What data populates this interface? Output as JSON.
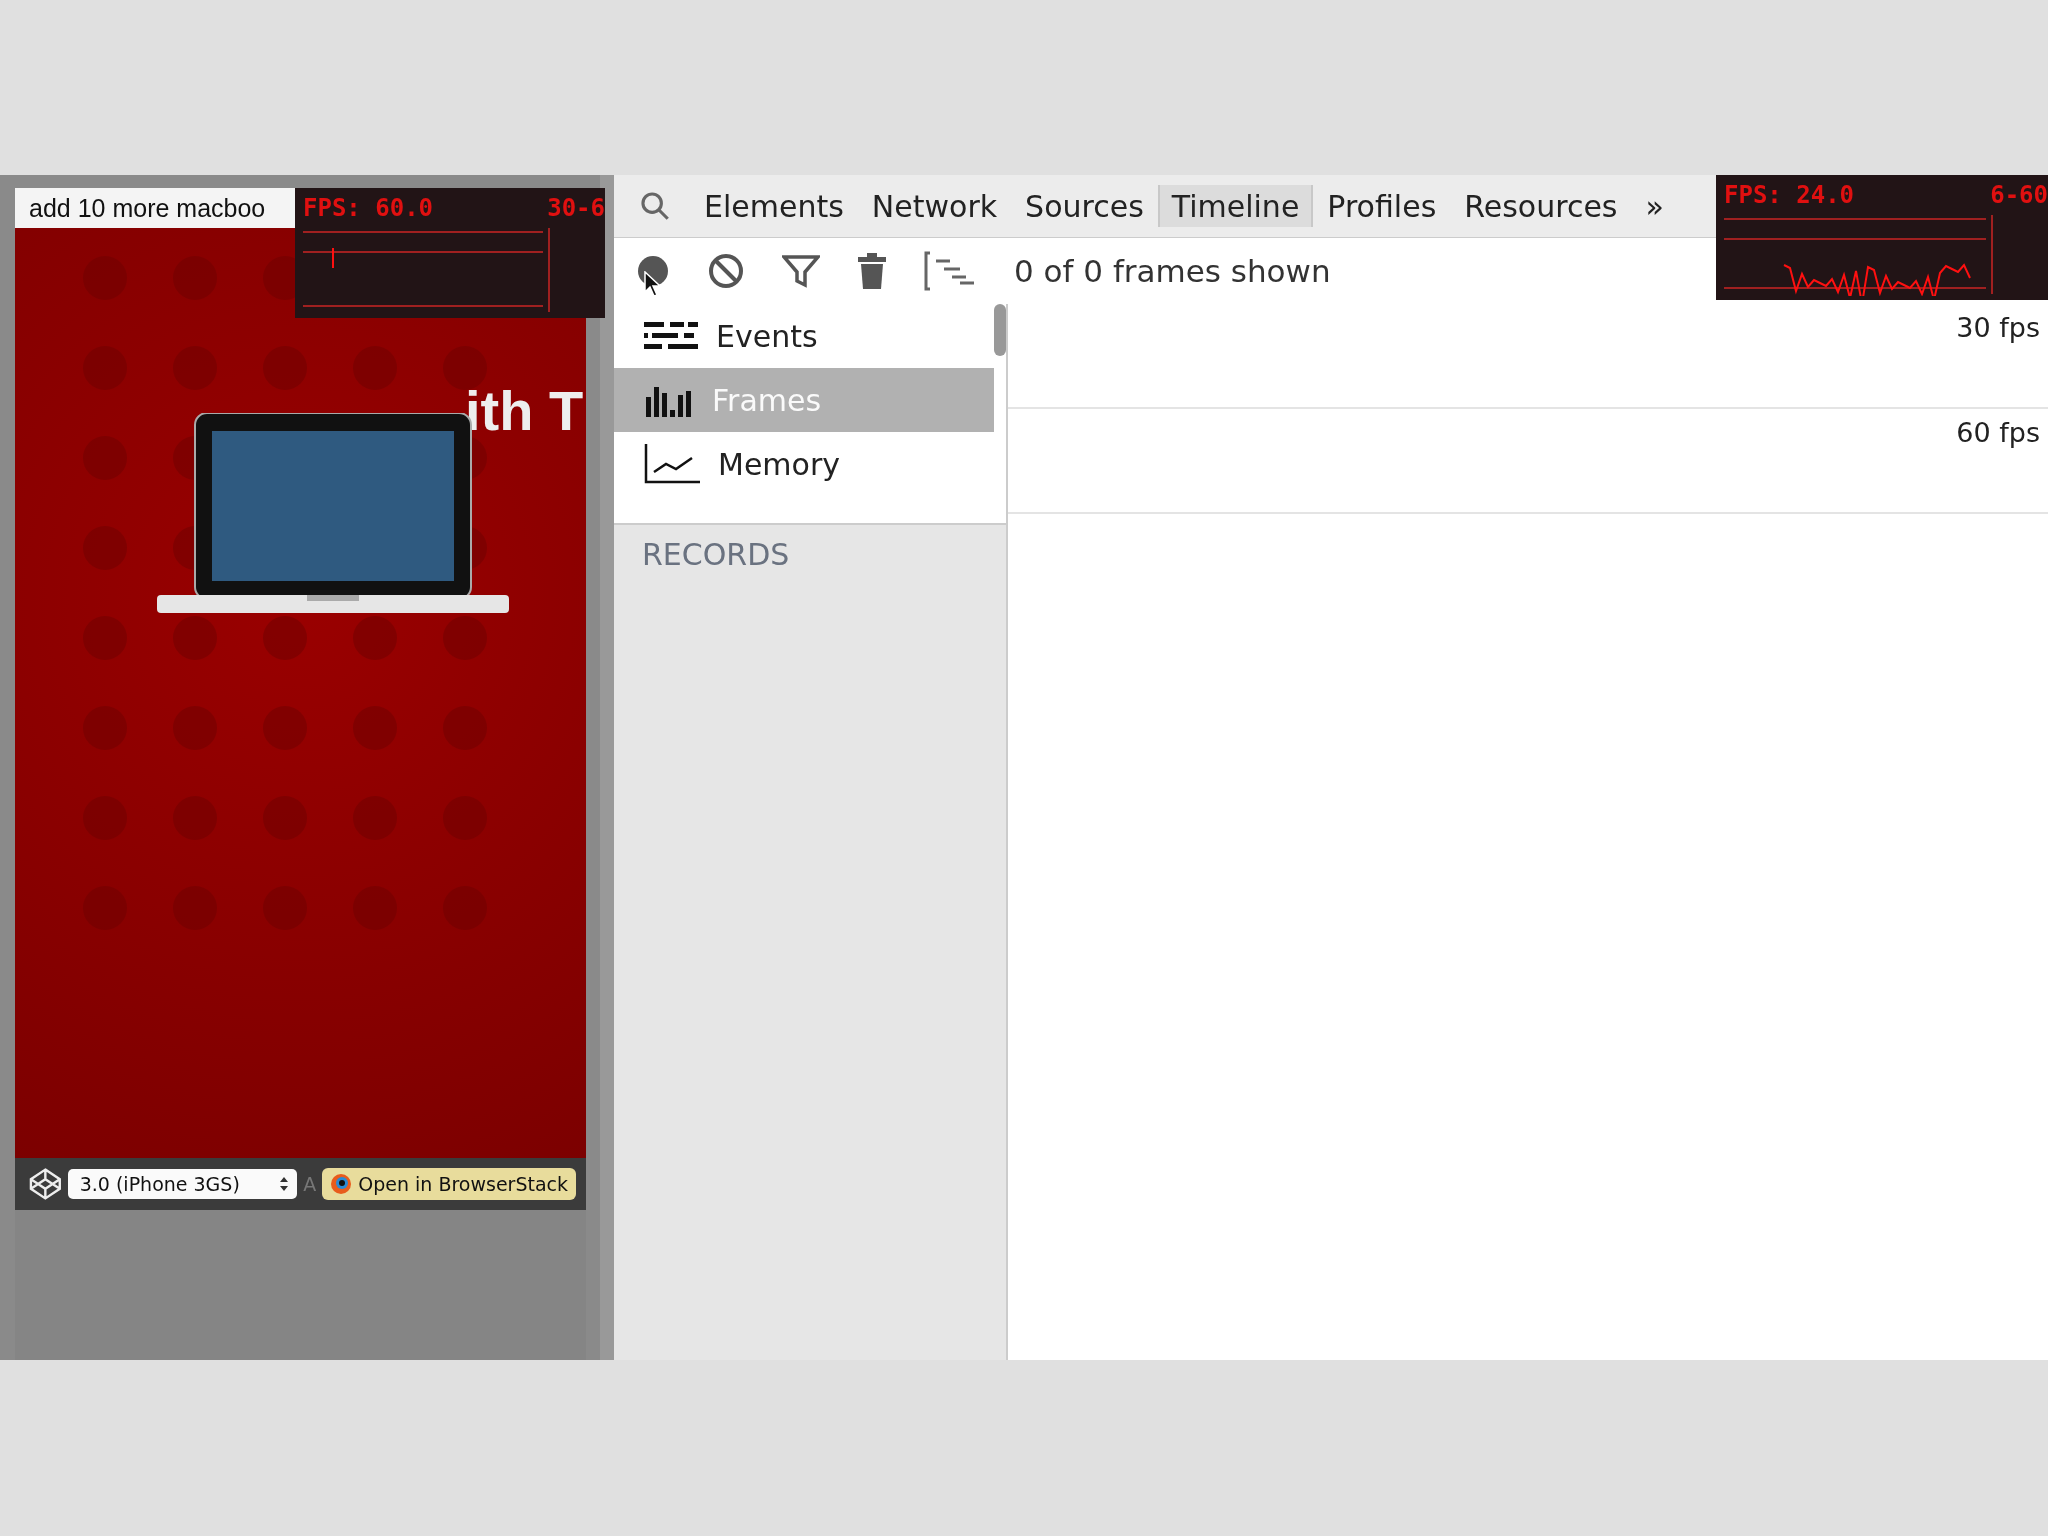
{
  "preview": {
    "top_button": "add 10 more macboo",
    "fps_meter": {
      "reading": "FPS: 60.0",
      "range": "30-6"
    },
    "heading_right": "ith T",
    "device_select": {
      "value": "3.0 (iPhone 3GS)"
    },
    "stray_letter": "A",
    "browserstack_button": "Open in BrowserStack"
  },
  "devtools": {
    "tabs": [
      {
        "label": "Elements",
        "selected": false
      },
      {
        "label": "Network",
        "selected": false
      },
      {
        "label": "Sources",
        "selected": false
      },
      {
        "label": "Timeline",
        "selected": true
      },
      {
        "label": "Profiles",
        "selected": false
      },
      {
        "label": "Resources",
        "selected": false
      }
    ],
    "more": "»",
    "fps_meter": {
      "reading": "FPS: 24.0",
      "range": "6-60"
    },
    "toolbar": {
      "recording": false,
      "status": "0 of 0 frames shown"
    },
    "sidebar": {
      "items": [
        {
          "label": "Events",
          "kind": "events",
          "selected": false
        },
        {
          "label": "Frames",
          "kind": "frames",
          "selected": true
        },
        {
          "label": "Memory",
          "kind": "memory",
          "selected": false
        }
      ],
      "section": "RECORDS"
    },
    "overview": {
      "labels": [
        "30 fps",
        "60 fps"
      ]
    }
  }
}
